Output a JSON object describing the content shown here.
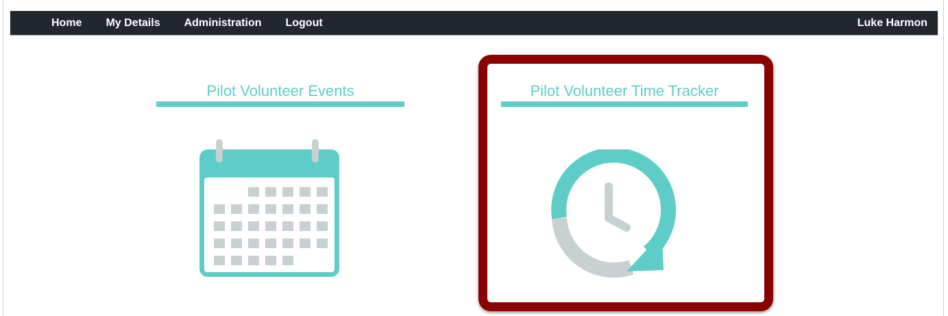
{
  "navbar": {
    "items": [
      {
        "label": "Home"
      },
      {
        "label": "My Details"
      },
      {
        "label": "Administration"
      },
      {
        "label": "Logout"
      }
    ],
    "user_name": "Luke Harmon"
  },
  "tiles": [
    {
      "title": "Pilot Volunteer Events",
      "icon": "calendar-icon"
    },
    {
      "title": "Pilot Volunteer Time Tracker",
      "icon": "clock-icon"
    }
  ],
  "colors": {
    "navbar_bg": "#22262d",
    "accent_teal": "#5ecdc8",
    "highlight_red": "#8b0000",
    "icon_grey": "#c8d0d2"
  }
}
